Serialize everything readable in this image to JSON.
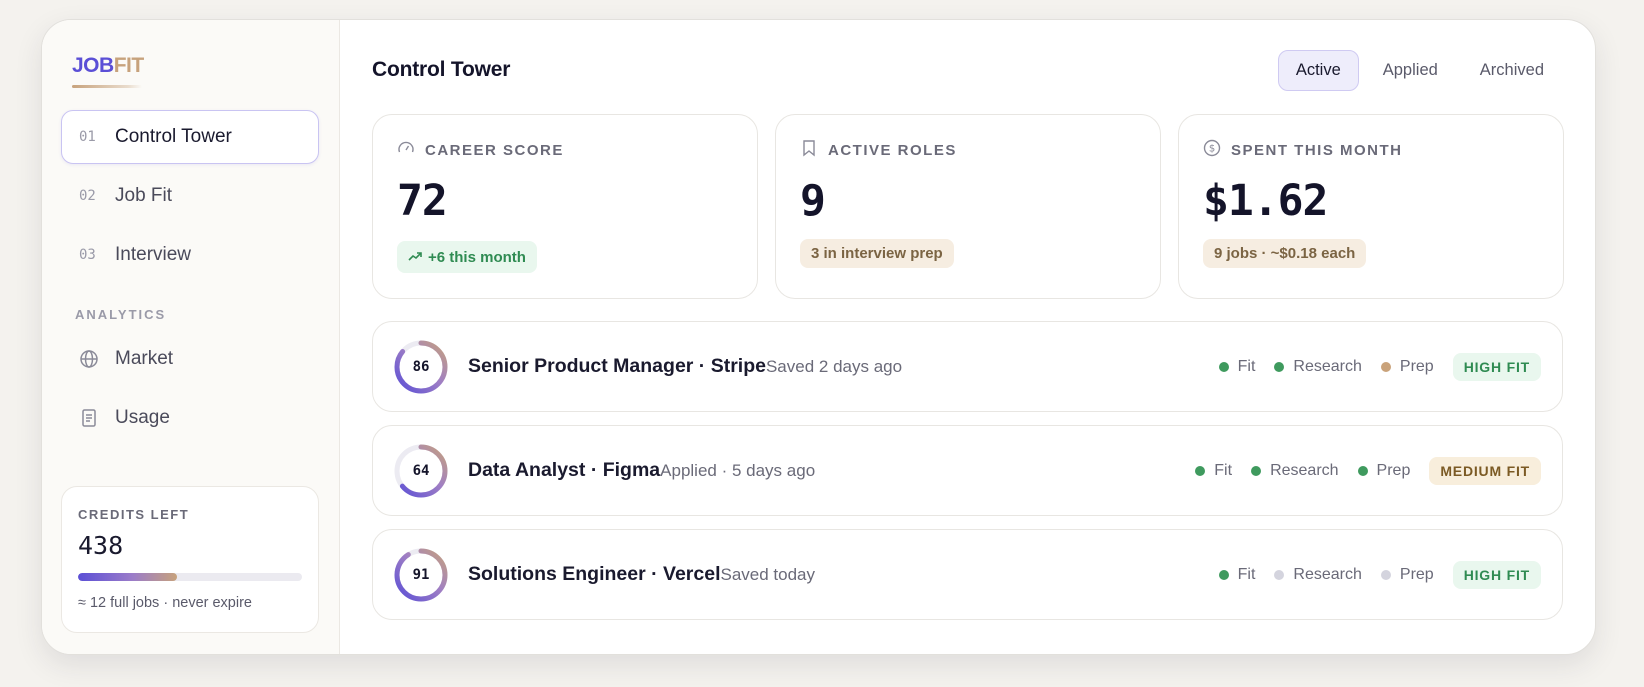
{
  "brand": {
    "logo_part1": "JOB",
    "logo_part2": "FIT"
  },
  "sidebar": {
    "nav": [
      {
        "num": "01",
        "label": "Control Tower",
        "active": true
      },
      {
        "num": "02",
        "label": "Job Fit"
      },
      {
        "num": "03",
        "label": "Interview"
      }
    ],
    "section_label": "ANALYTICS",
    "analytics": [
      {
        "label": "Market",
        "icon": "globe-icon"
      },
      {
        "label": "Usage",
        "icon": "document-icon"
      }
    ],
    "credits": {
      "label": "CREDITS LEFT",
      "value": "438",
      "fill_fraction": 0.44,
      "note": "≈ 12 full jobs · never expire"
    }
  },
  "header": {
    "title": "Control Tower",
    "tabs": [
      "Active",
      "Applied",
      "Archived"
    ],
    "active_tab": "Active"
  },
  "stats": [
    {
      "icon": "gauge-icon",
      "label": "CAREER SCORE",
      "value": "72",
      "pill": "+6 this month",
      "pill_icon": "trend-up-icon"
    },
    {
      "icon": "bookmark-icon",
      "label": "ACTIVE ROLES",
      "value": "9",
      "pill": "3 in interview prep"
    },
    {
      "icon": "dollar-icon",
      "label": "SPENT THIS MONTH",
      "value": "$1.62",
      "pill": "9 jobs · ~$0.18 each"
    }
  ],
  "jobs": [
    {
      "score": "86",
      "score_value": 86,
      "title": "Senior Product Manager · Stripe",
      "meta": "Saved 2 days ago",
      "steps": [
        {
          "label": "Fit",
          "color": "#3f9a5e"
        },
        {
          "label": "Research",
          "color": "#3f9a5e"
        },
        {
          "label": "Prep",
          "color": "#c9a27a"
        }
      ],
      "badge": "HIGH FIT",
      "badge_kind": "high"
    },
    {
      "score": "64",
      "score_value": 64,
      "title": "Data Analyst · Figma",
      "meta": "Applied · 5 days ago",
      "steps": [
        {
          "label": "Fit",
          "color": "#3f9a5e"
        },
        {
          "label": "Research",
          "color": "#3f9a5e"
        },
        {
          "label": "Prep",
          "color": "#3f9a5e"
        }
      ],
      "badge": "MEDIUM FIT",
      "badge_kind": "medium"
    },
    {
      "score": "91",
      "score_value": 91,
      "title": "Solutions Engineer · Vercel",
      "meta": "Saved today",
      "steps": [
        {
          "label": "Fit",
          "color": "#3f9a5e"
        },
        {
          "label": "Research",
          "color": "#d4d4de"
        },
        {
          "label": "Prep",
          "color": "#d4d4de"
        }
      ],
      "badge": "HIGH FIT",
      "badge_kind": "high"
    }
  ],
  "colors": {
    "accent": "#5b4fd6",
    "sand": "#c7a27c",
    "success": "#3f9a5e"
  }
}
